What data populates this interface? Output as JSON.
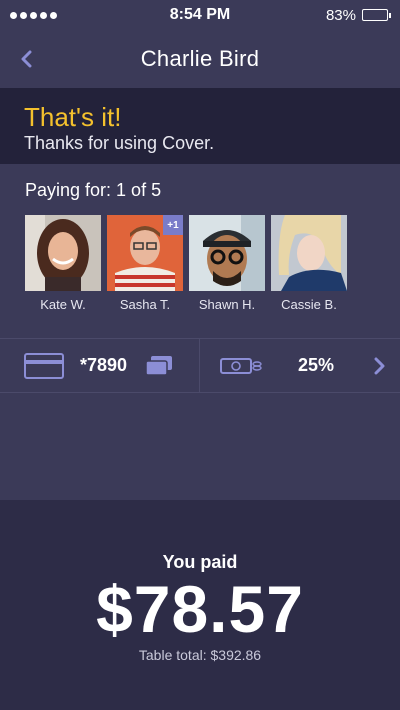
{
  "statusbar": {
    "time": "8:54 PM",
    "battery": "83%",
    "battery_level": 0.83
  },
  "nav": {
    "title": "Charlie Bird"
  },
  "banner": {
    "title": "That's it!",
    "subtitle": "Thanks for using Cover."
  },
  "paying": {
    "label": "Paying for: 1 of 5",
    "people": [
      {
        "name": "Kate W."
      },
      {
        "name": "Sasha T.",
        "badge": "+1"
      },
      {
        "name": "Shawn H."
      },
      {
        "name": "Cassie B."
      }
    ]
  },
  "payment": {
    "card_number": "*7890",
    "tip": "25%"
  },
  "summary": {
    "you_paid_label": "You paid",
    "amount": "$78.57",
    "table_total": "Table total: $392.86"
  },
  "colors": {
    "accent": "#f4c12d",
    "background": "#3b3a58",
    "banner": "#23223a",
    "footer": "#2d2c47"
  },
  "icons": [
    "back-chevron-icon",
    "credit-card-icon",
    "cards-stack-icon",
    "cash-icon",
    "chevron-right-icon"
  ]
}
